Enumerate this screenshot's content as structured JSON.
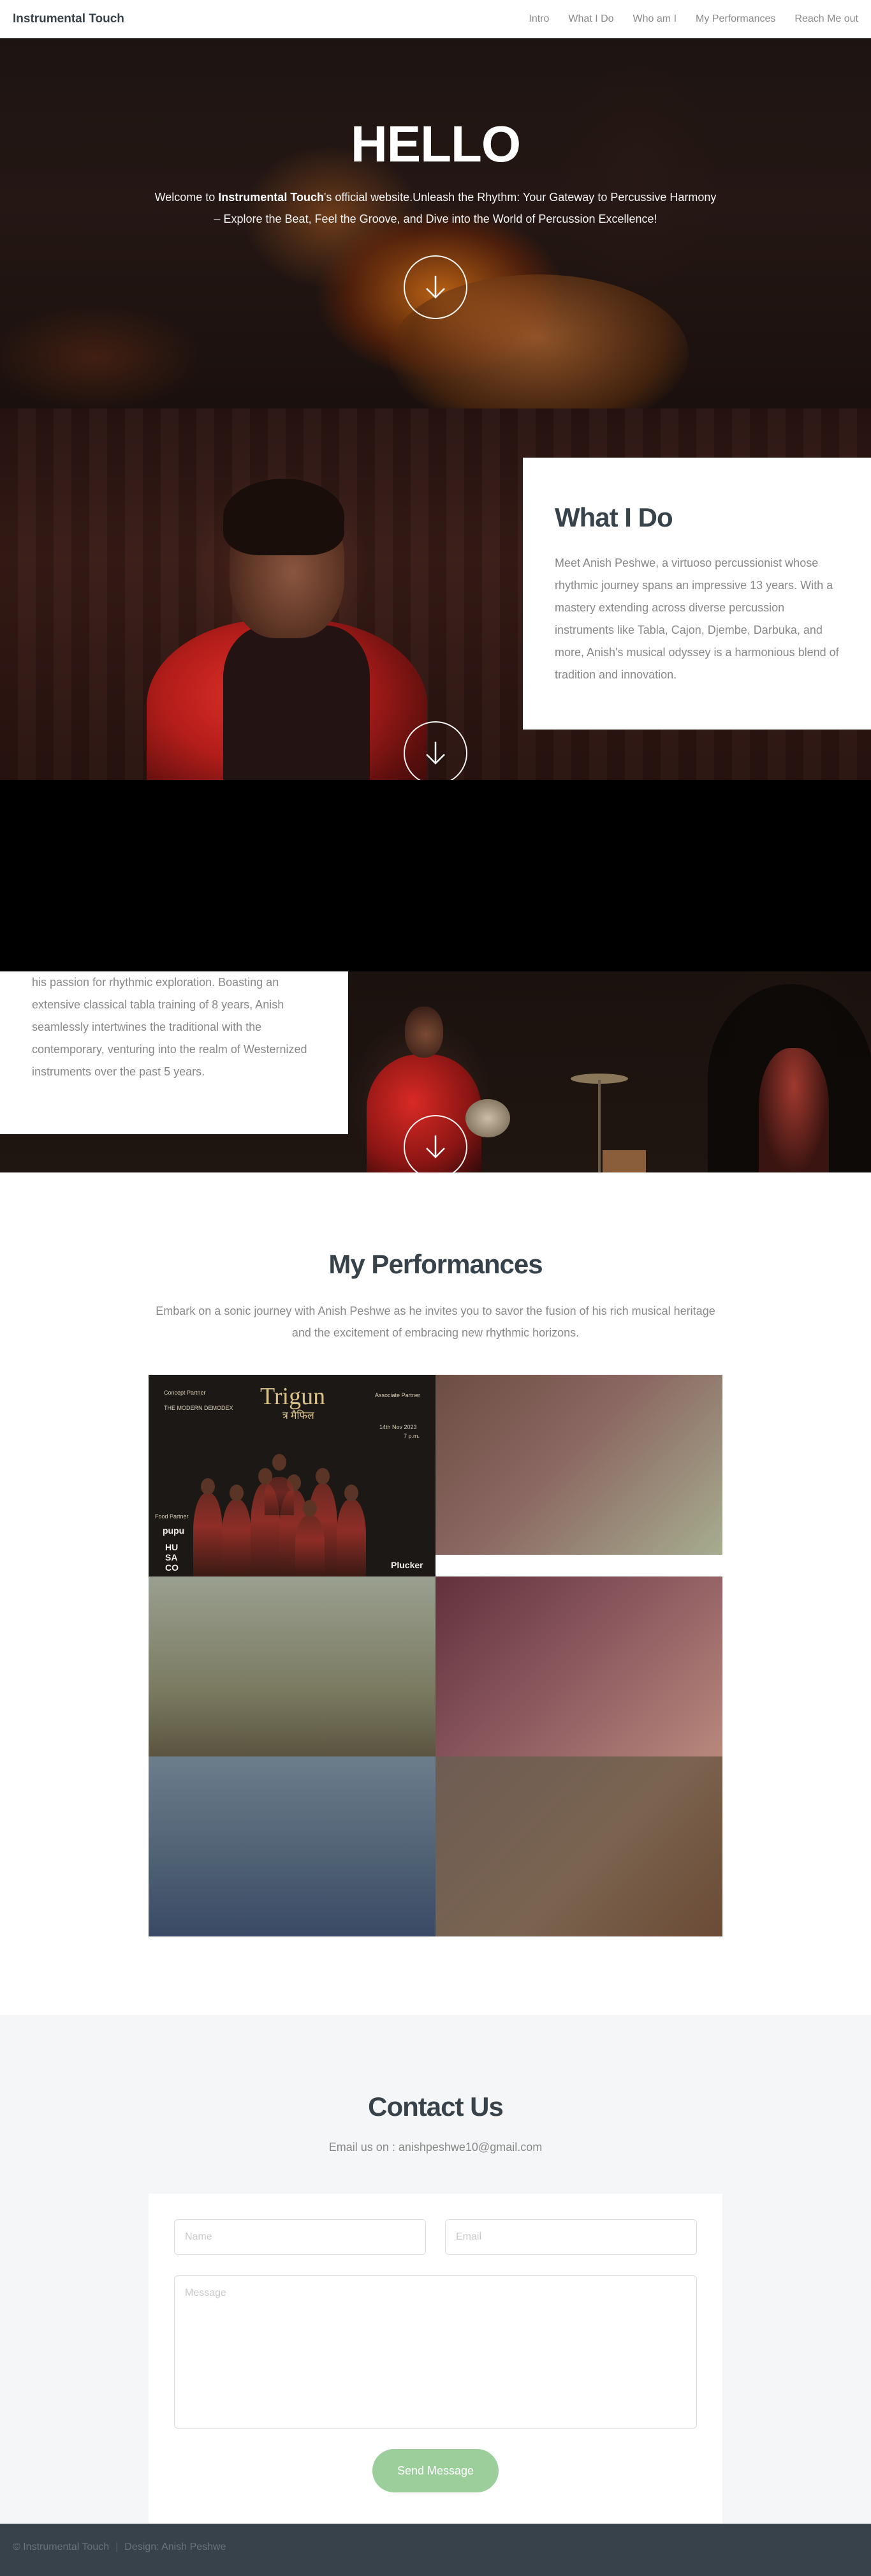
{
  "header": {
    "logo": "Instrumental Touch",
    "nav": [
      "Intro",
      "What I Do",
      "Who am I",
      "My Performances",
      "Reach Me out"
    ]
  },
  "intro": {
    "title": "HELLO",
    "text_prefix": "Welcome to ",
    "text_bold": "Instrumental Touch",
    "text_suffix": "'s official website.Unleash the Rhythm: Your Gateway to Percussive Harmony – Explore the Beat, Feel the Groove, and Dive into the World of Percussion Excellence!"
  },
  "what_i_do": {
    "title": "What I Do",
    "text": "Meet Anish Peshwe, a virtuoso percussionist whose rhythmic journey spans an impressive 13 years. With a mastery extending across diverse percussion instruments like Tabla, Cajon, Djembe, Darbuka, and more, Anish's musical odyssey is a harmonious blend of tradition and innovation."
  },
  "who_am_i": {
    "text": "Anish's dedication to the art of music is as evident as his passion for rhythmic exploration. Boasting an extensive classical tabla training of 8 years, Anish seamlessly intertwines the traditional with the contemporary, venturing into the realm of Westernized instruments over the past 5 years."
  },
  "performances": {
    "title": "My Performances",
    "subtitle": "Embark on a sonic journey with Anish Peshwe as he invites you to savor the fusion of his rich musical heritage and the excitement of embracing new rhythmic horizons.",
    "poster": {
      "title": "Trigun",
      "subtitle": "त्र मैफिल",
      "concept_partner": "Concept Partner",
      "concept_name": "THE MODERN DEMODEX",
      "associate": "Associate Partner",
      "date": "14th Nov 2023",
      "time": "7 p.m.",
      "food_partner": "Food Partner",
      "logo_left_1": "pupu",
      "logo_left_2": "HU\nSA\nCO",
      "logo_right": "Plucker"
    }
  },
  "contact": {
    "title": "Contact Us",
    "email_line": "Email us on : anishpeshwe10@gmail.com",
    "name_placeholder": "Name",
    "email_placeholder": "Email",
    "message_placeholder": "Message",
    "send_label": "Send Message"
  },
  "footer": {
    "copyright": "© Instrumental Touch",
    "design": "Design: Anish Peshwe"
  }
}
